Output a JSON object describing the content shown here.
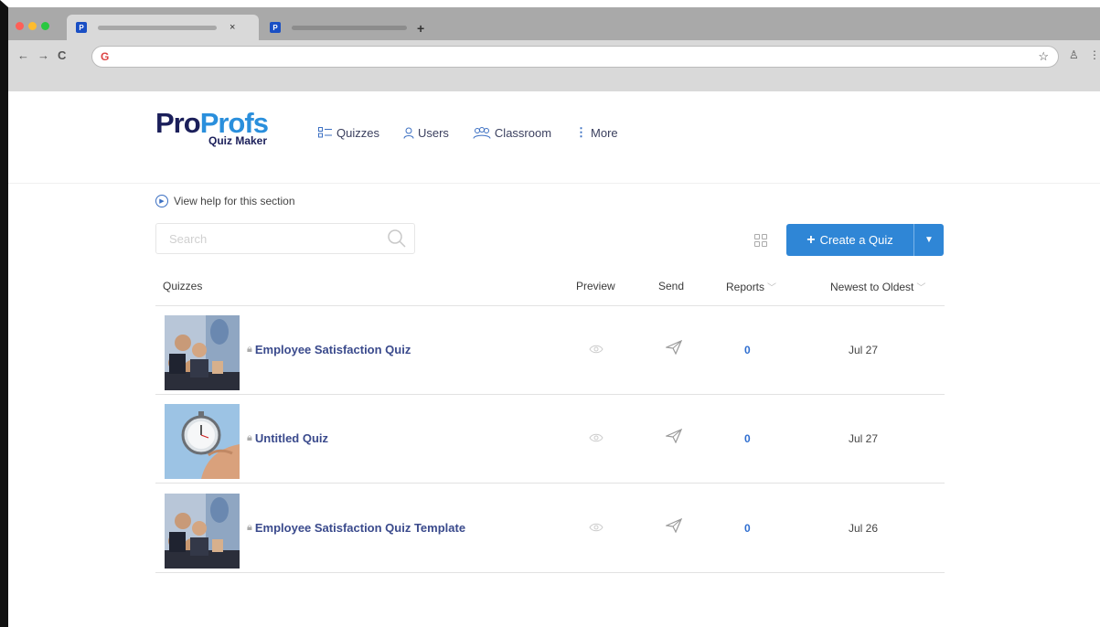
{
  "browser": {
    "tabs": [
      {
        "favicon": "P"
      },
      {
        "favicon": "P"
      }
    ],
    "tab_close": "×",
    "new_tab": "+",
    "omnibox_icon": "G",
    "colors": {
      "close": "#ff5f57",
      "minimize": "#febc2e",
      "zoom": "#28c840"
    }
  },
  "logo": {
    "pro": "Pro",
    "profs": "Profs",
    "sub": "Quiz Maker"
  },
  "nav": {
    "quizzes": "Quizzes",
    "users": "Users",
    "classroom": "Classroom",
    "more": "More"
  },
  "help": {
    "label": "View help for this section"
  },
  "search": {
    "placeholder": "Search"
  },
  "actions": {
    "create_label": "Create a Quiz"
  },
  "table": {
    "headers": {
      "quizzes": "Quizzes",
      "preview": "Preview",
      "send": "Send",
      "reports": "Reports",
      "sort": "Newest to Oldest"
    },
    "rows": [
      {
        "title": "Employee Satisfaction Quiz",
        "reports": "0",
        "date": "Jul 27"
      },
      {
        "title": "Untitled Quiz",
        "reports": "0",
        "date": "Jul 27"
      },
      {
        "title": "Employee Satisfaction Quiz Template",
        "reports": "0",
        "date": "Jul 26"
      }
    ]
  },
  "colors": {
    "accent": "#2f86d6",
    "brand_dark": "#1b1f5a",
    "brand_light": "#2a8fdc",
    "link": "#3a4a8c"
  }
}
